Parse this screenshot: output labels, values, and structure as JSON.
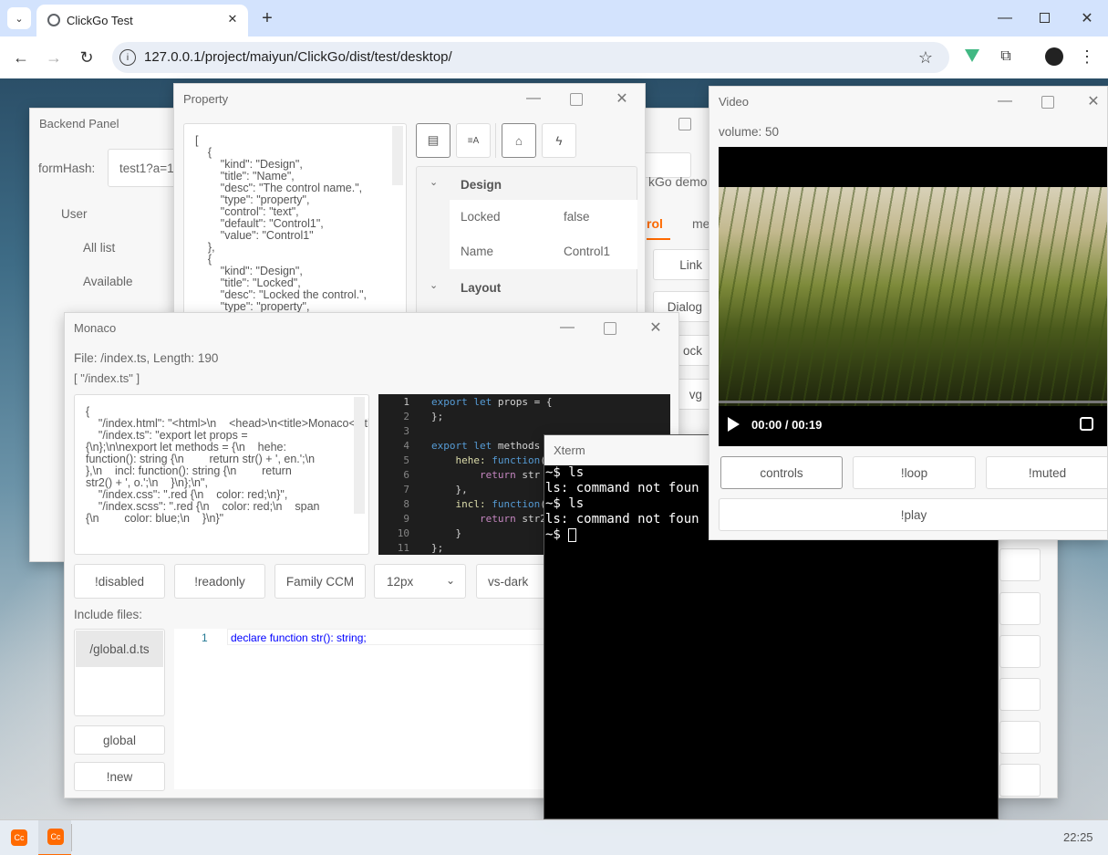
{
  "browser": {
    "tab_title": "ClickGo Test",
    "url": "127.0.0.1/project/maiyun/ClickGo/dist/test/desktop/"
  },
  "backend": {
    "title": "Backend Panel",
    "form_hash_label": "formHash:",
    "form_hash_value": "test1?a=1&",
    "menu": [
      "User",
      "All list",
      "Available"
    ]
  },
  "property": {
    "title": "Property",
    "json_lines": [
      "[",
      "    {",
      "        \"kind\": \"Design\",",
      "        \"title\": \"Name\",",
      "        \"desc\": \"The control name.\",",
      "        \"type\": \"property\",",
      "        \"control\": \"text\",",
      "        \"default\": \"Control1\",",
      "        \"value\": \"Control1\"",
      "    },",
      "    {",
      "        \"kind\": \"Design\",",
      "        \"title\": \"Locked\",",
      "        \"desc\": \"Locked the control.\",",
      "        \"type\": \"property\","
    ],
    "groups": [
      {
        "name": "Design",
        "rows": [
          {
            "name": "Locked",
            "value": "false"
          },
          {
            "name": "Name",
            "value": "Control1"
          }
        ]
      },
      {
        "name": "Layout",
        "rows": []
      }
    ]
  },
  "background_window": {
    "fragments": [
      "kGo demo",
      "rol",
      "me",
      "Link",
      "Dialog",
      "ock",
      "vg"
    ]
  },
  "monaco": {
    "title": "Monaco",
    "file_info": "File: /index.ts, Length: 190",
    "files_list": "[ \"/index.ts\" ]",
    "json_text": "{\n    \"/index.html\": \"<html>\\n    <head>\\n<title>Monaco</title>\\n    </head>\\n<body>\\n        Hello Monaco Editor!\\n</body>\\n</html>\",\n    \"/index.ts\": \"export let props =\n{\\n};\\n\\nexport let methods = {\\n    hehe:\nfunction(): string {\\n        return str() + ', en.';\\n\n},\\n    incl: function(): string {\\n        return\nstr2() + ', o.';\\n    }\\n};\\n\",\n    \"/index.css\": \".red {\\n    color: red;\\n}\",\n    \"/index.scss\": \".red {\\n    color: red;\\n    span\n{\\n        color: blue;\\n    }\\n}\"",
    "code_lines": [
      {
        "n": "1",
        "t": "export let props = {"
      },
      {
        "n": "2",
        "t": "};"
      },
      {
        "n": "3",
        "t": ""
      },
      {
        "n": "4",
        "t": "export let methods"
      },
      {
        "n": "5",
        "t": "    hehe: function("
      },
      {
        "n": "6",
        "t": "        return str"
      },
      {
        "n": "7",
        "t": "    },"
      },
      {
        "n": "8",
        "t": "    incl: function("
      },
      {
        "n": "9",
        "t": "        return str2"
      },
      {
        "n": "10",
        "t": "    }"
      },
      {
        "n": "11",
        "t": "};"
      }
    ],
    "buttons": [
      "!disabled",
      "!readonly",
      "Family CCM"
    ],
    "font_size": "12px",
    "theme": "vs-dark",
    "include_label": "Include files:",
    "include_file": "/global.d.ts",
    "global_button": "global",
    "new_button": "!new",
    "decl_line_no": "1",
    "decl_code": "declare function str(): string;"
  },
  "video": {
    "title": "Video",
    "volume": "volume: 50",
    "time": "00:00 / 00:19",
    "buttons": [
      "controls",
      "!loop",
      "!muted"
    ],
    "play_button": "!play"
  },
  "xterm": {
    "title": "Xterm",
    "lines": [
      "~$ ls",
      "ls: command not foun",
      "~$ ls",
      "ls: command not foun",
      "~$ "
    ]
  },
  "taskbar": {
    "clock": "22:25"
  },
  "colors": {
    "accent": "#ff6a00",
    "tab_bar": "#d3e3fd",
    "terminal_bg": "#000000"
  }
}
